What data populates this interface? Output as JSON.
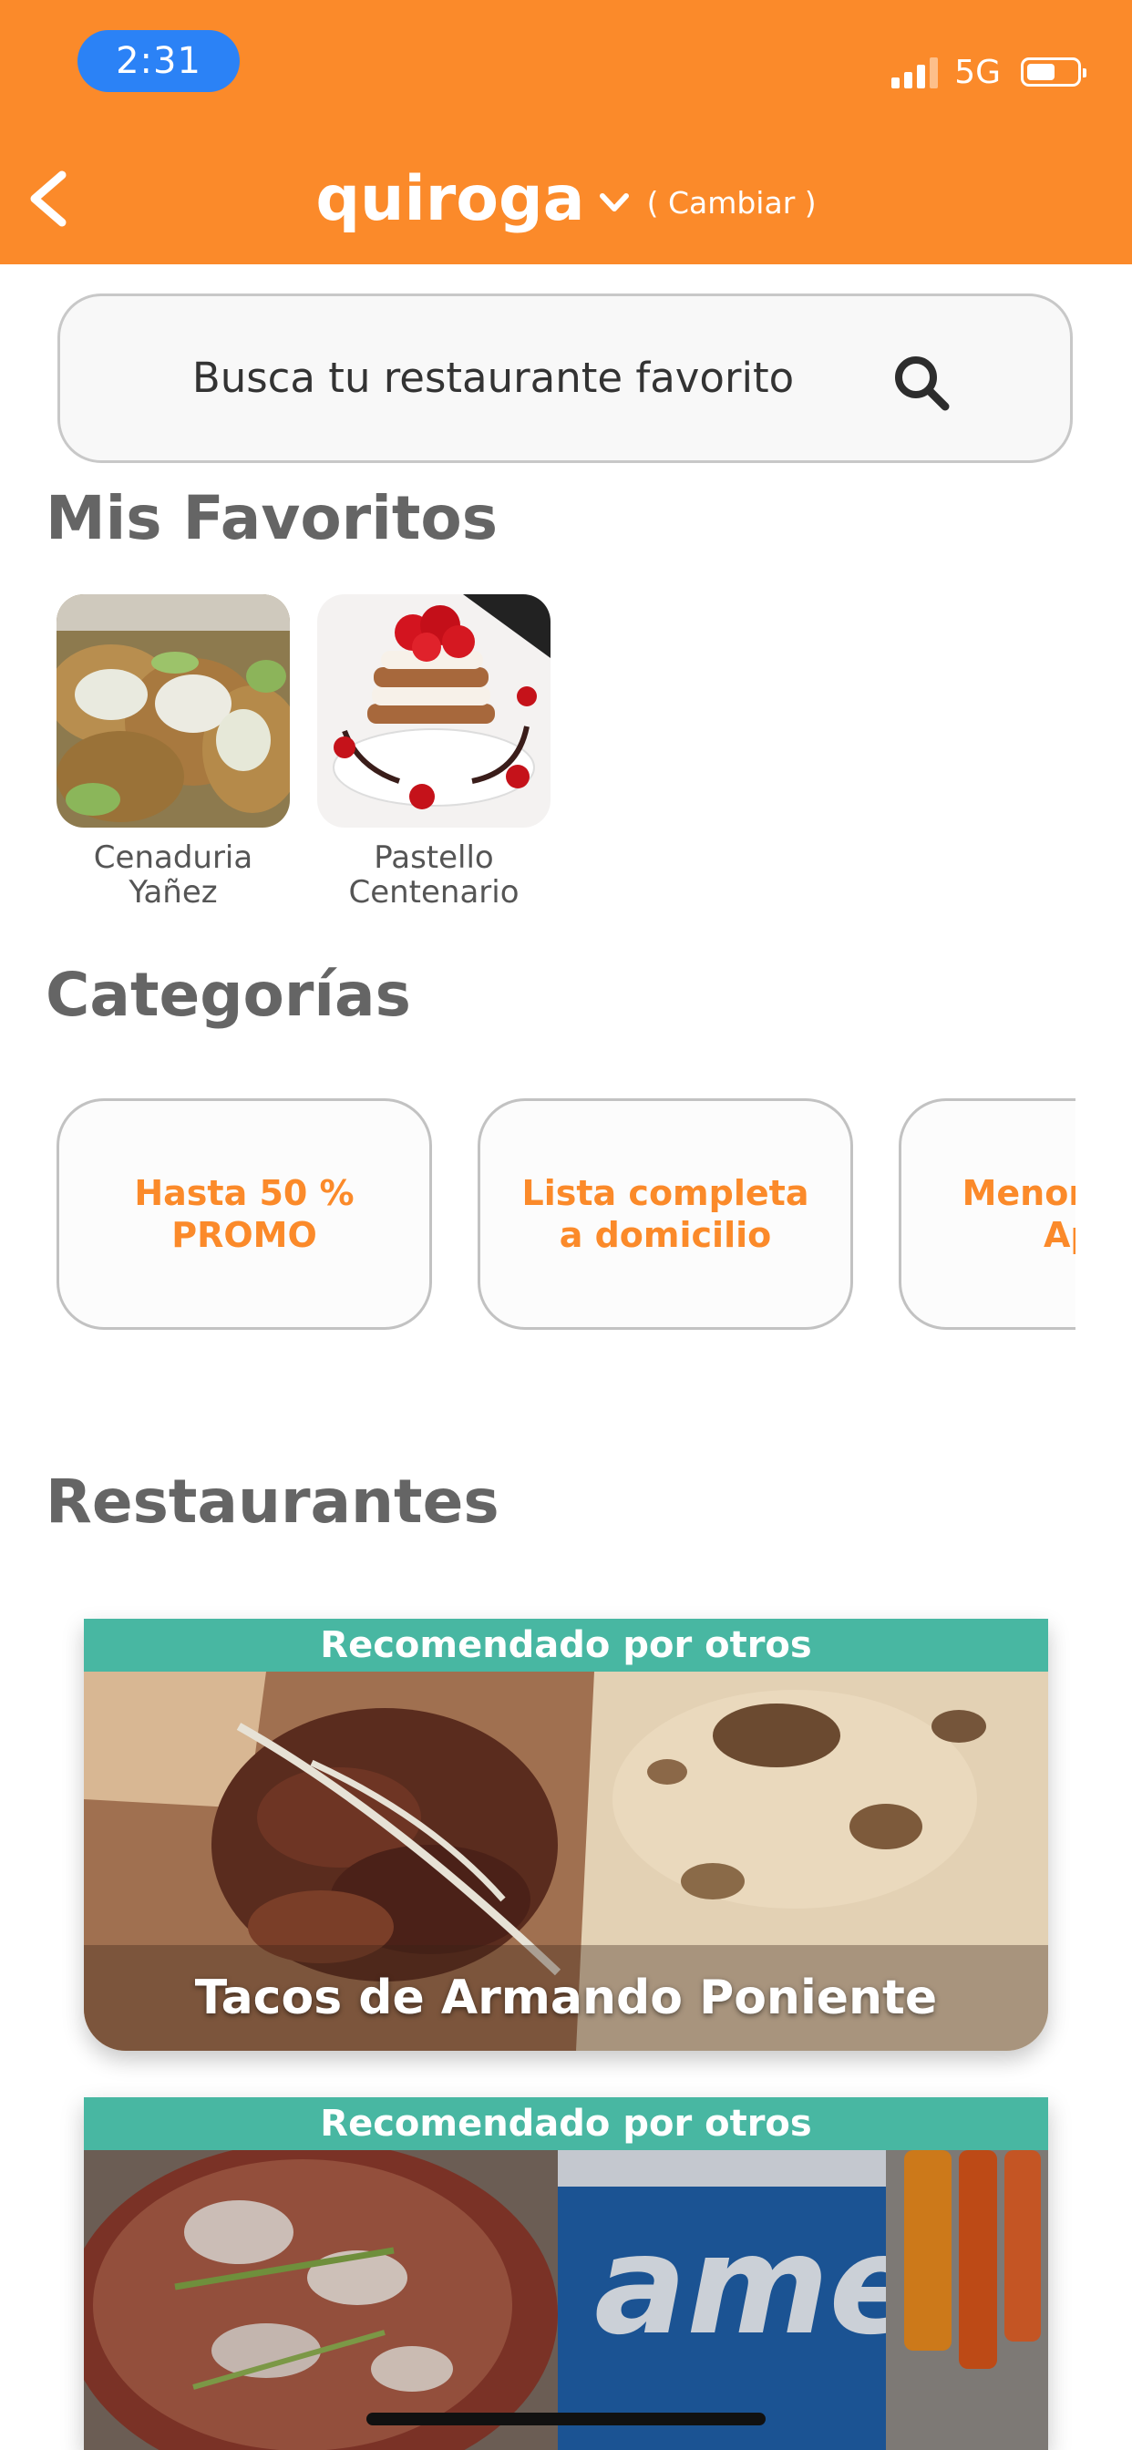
{
  "theme": {
    "accent": "#FB8A2A",
    "teal": "#48B7A2"
  },
  "status_bar": {
    "time": "2:31",
    "network": "5G",
    "icons": [
      "signal-icon",
      "battery-icon"
    ]
  },
  "header": {
    "city": "quiroga",
    "change_label": "( Cambiar )",
    "back_icon": "chevron-left-icon",
    "dropdown_icon": "chevron-down-icon"
  },
  "search": {
    "placeholder": "Busca tu restaurante favorito",
    "icon": "search-icon"
  },
  "favorites": {
    "title": "Mis Favoritos",
    "items": [
      {
        "line1": "Cenaduria",
        "line2": "Yañez"
      },
      {
        "line1": "Pastello",
        "line2": "Centenario"
      }
    ]
  },
  "categories": {
    "title": "Categorías",
    "items": [
      {
        "label": "Hasta 50 % PROMO"
      },
      {
        "line1": "Lista completa",
        "line2": "a domicilio"
      },
      {
        "line1": "Menor",
        "line2": "Ap"
      }
    ]
  },
  "restaurants": {
    "title": "Restaurantes",
    "items": [
      {
        "banner": "Recomendado por otros",
        "name": "Tacos de Armando  Poniente"
      },
      {
        "banner": "Recomendado por otros",
        "name": ""
      }
    ]
  }
}
